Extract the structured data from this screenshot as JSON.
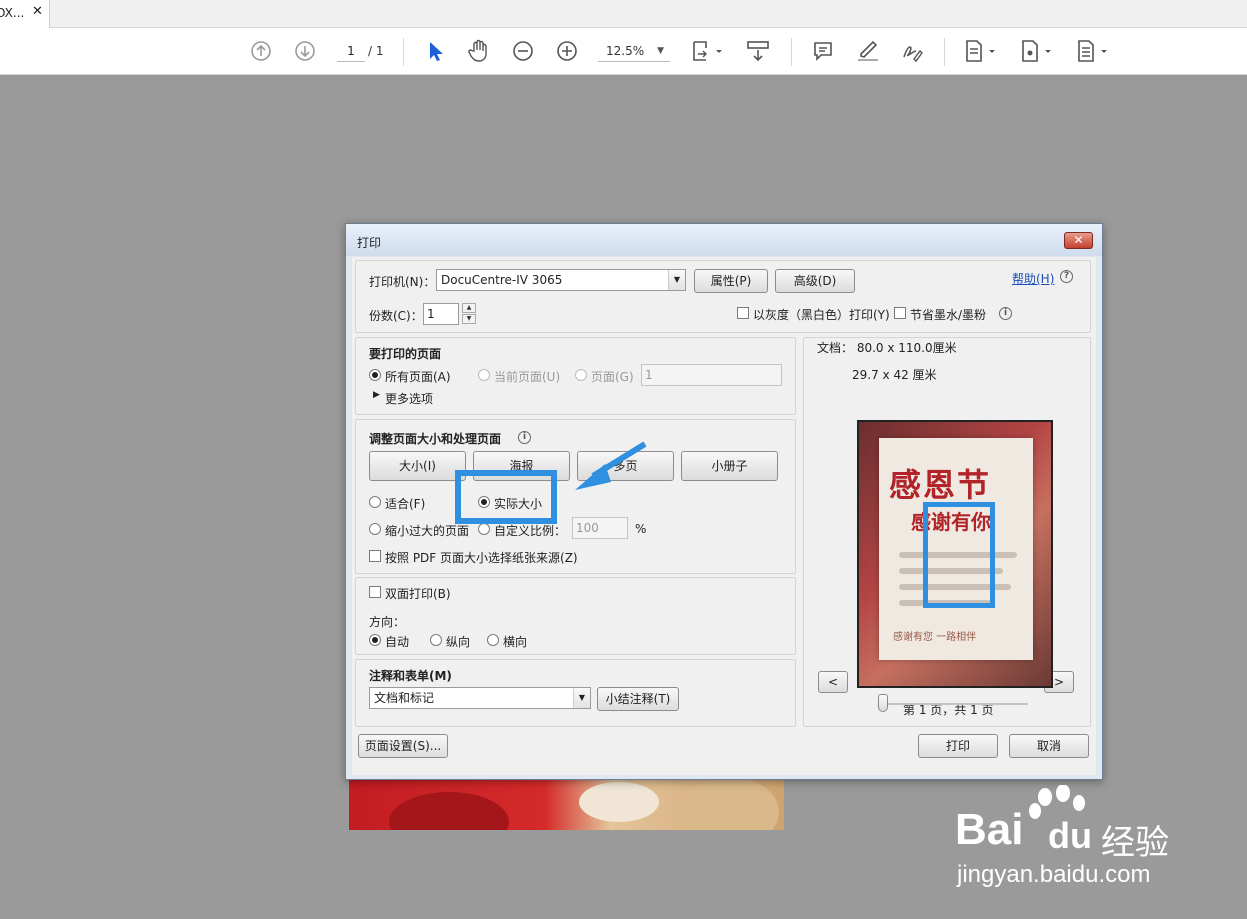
{
  "tab": {
    "title": "OX...",
    "close": "✕"
  },
  "toolbar": {
    "page_current": "1",
    "page_total": "/ 1",
    "zoom": "12.5%",
    "icons": [
      "arrow-up-circle-icon",
      "arrow-down-circle-icon",
      "cursor-icon",
      "hand-icon",
      "zoom-out-icon",
      "zoom-in-icon",
      "fit-page-icon",
      "scroll-mode-icon",
      "comment-icon",
      "highlight-pen-icon",
      "sign-icon",
      "page-tools-icon",
      "export-icon",
      "more-page-icon"
    ]
  },
  "dialog": {
    "title": "打印",
    "close": "✕",
    "printer": {
      "label": "打印机(N)：",
      "value": "DocuCentre-IV 3065",
      "properties_btn": "属性(P)",
      "advanced_btn": "高级(D)",
      "help_link": "帮助(H)"
    },
    "copies": {
      "label": "份数(C)：",
      "value": "1",
      "grayscale": "以灰度（黑白色）打印(Y)",
      "save_ink": "节省墨水/墨粉"
    },
    "pages": {
      "title": "要打印的页面",
      "all": "所有页面(A)",
      "current": "当前页面(U)",
      "range": "页面(G)",
      "range_value": "1",
      "more": "更多选项"
    },
    "sizing": {
      "title": "调整页面大小和处理页面",
      "tabs": [
        "大小(I)",
        "海报",
        "多页",
        "小册子"
      ],
      "fit": "适合(F)",
      "actual": "实际大小",
      "shrink": "缩小过大的页面",
      "custom": "自定义比例：",
      "custom_value": "100",
      "percent": "%",
      "paper_source": "按照 PDF 页面大小选择纸张来源(Z)"
    },
    "duplex": {
      "label": "双面打印(B)",
      "orientation_label": "方向：",
      "auto": "自动",
      "portrait": "纵向",
      "landscape": "横向"
    },
    "comments": {
      "title": "注释和表单(M)",
      "value": "文档和标记",
      "summary_btn": "小结注释(T)"
    },
    "preview": {
      "doc_size": "文档：  80.0 x 110.0厘米",
      "paper_size": "29.7 x 42 厘米",
      "prev": "<",
      "next": ">",
      "page_info": "第 1 页，共 1 页",
      "calligraphy": "感恩节",
      "calligraphy2": "感谢有你",
      "footer": "感谢有您    一路相伴"
    },
    "footer": {
      "page_setup": "页面设置(S)...",
      "print": "打印",
      "cancel": "取消"
    }
  },
  "watermark": {
    "brand": "Bai",
    "brand2": "du",
    "cn": "经验",
    "url": "jingyan.baidu.com"
  },
  "colors": {
    "highlight": "#2f8fe0",
    "link": "#1a4fb8",
    "close_red": "#c3402d"
  }
}
